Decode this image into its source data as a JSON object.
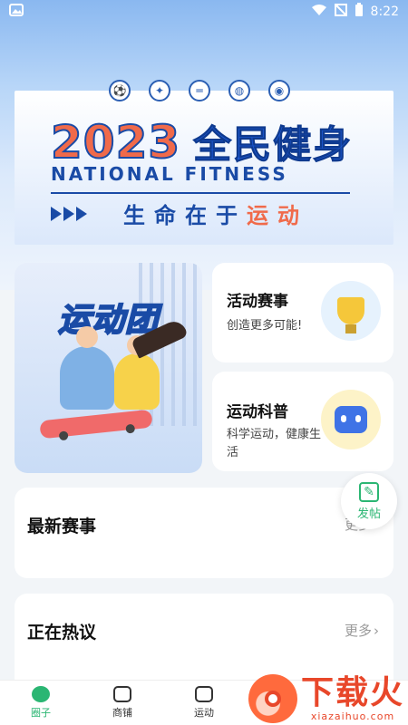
{
  "status_bar": {
    "time": "8:22"
  },
  "banner": {
    "year": "2023",
    "cn_title": "全民健身",
    "en_title": "NATIONAL FITNESS",
    "slogan_main": "生命在于",
    "slogan_highlight": "运动",
    "sport_icons": [
      "soccer-ball-icon",
      "shuttlecock-icon",
      "dumbbell-icon",
      "basketball-icon",
      "volleyball-icon"
    ]
  },
  "cards": {
    "team": {
      "title": "运动团"
    },
    "events": {
      "title": "活动赛事",
      "desc": "创造更多可能!"
    },
    "science": {
      "title": "运动科普",
      "desc": "科学运动，健康生活"
    }
  },
  "post_button": {
    "label": "发帖"
  },
  "sections": {
    "latest": {
      "title": "最新赛事",
      "more": "更多"
    },
    "hot": {
      "title": "正在热议",
      "more": "更多"
    }
  },
  "tabbar": {
    "items": [
      {
        "label": "圈子",
        "icon": "circle-chat-icon",
        "active": true
      },
      {
        "label": "商铺",
        "icon": "shop-icon",
        "active": false
      },
      {
        "label": "运动",
        "icon": "sneaker-icon",
        "active": false
      }
    ]
  },
  "watermark": {
    "cn": "下载火",
    "en": "xiazaihuo.com"
  },
  "colors": {
    "accent": "#2bb673",
    "brand_blue": "#1a4ba6",
    "highlight": "#f06a4a"
  }
}
